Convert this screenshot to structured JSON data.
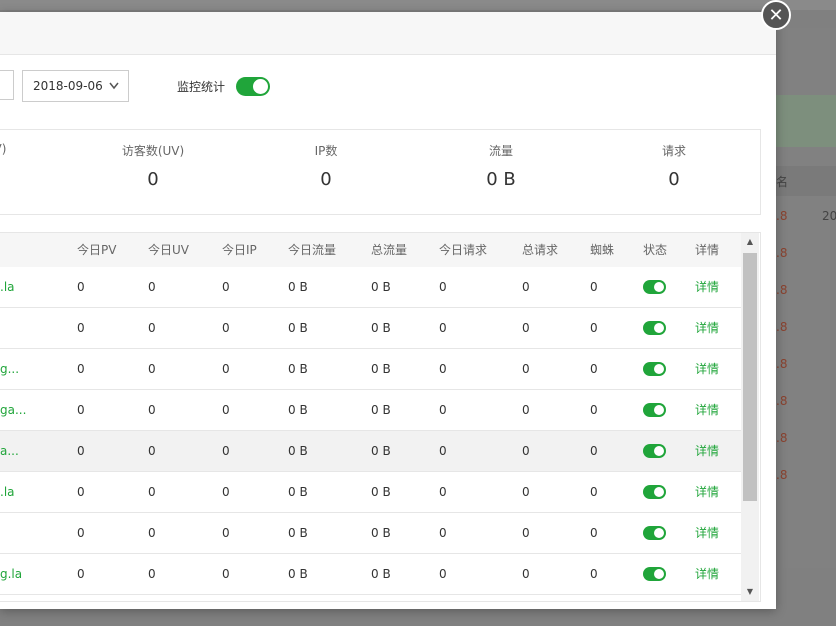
{
  "background": {
    "header_partial": "名",
    "rows": [
      ".8",
      ".8",
      ".8",
      ".8",
      ".8",
      ".8",
      ".8",
      ".8"
    ],
    "header_extra": "20"
  },
  "toolbar": {
    "date_value": "2018-09-06",
    "monitor_label": "监控统计",
    "monitor_enabled": true
  },
  "stats": [
    {
      "label": "V)",
      "value": ""
    },
    {
      "label": "访客数(UV)",
      "value": "0"
    },
    {
      "label": "IP数",
      "value": "0"
    },
    {
      "label": "流量",
      "value": "0 B"
    },
    {
      "label": "请求",
      "value": "0"
    }
  ],
  "table": {
    "headers": [
      "今日PV",
      "今日UV",
      "今日IP",
      "今日流量",
      "总流量",
      "今日请求",
      "总请求",
      "蜘蛛",
      "状态",
      "详情"
    ],
    "rows": [
      {
        "site": ".la",
        "pv": "0",
        "uv": "0",
        "ip": "0",
        "today_flow": "0 B",
        "total_flow": "0 B",
        "today_req": "0",
        "total_req": "0",
        "spider": "0",
        "status_on": true,
        "detail": "详情"
      },
      {
        "site": "",
        "pv": "0",
        "uv": "0",
        "ip": "0",
        "today_flow": "0 B",
        "total_flow": "0 B",
        "today_req": "0",
        "total_req": "0",
        "spider": "0",
        "status_on": true,
        "detail": "详情"
      },
      {
        "site": "g...",
        "pv": "0",
        "uv": "0",
        "ip": "0",
        "today_flow": "0 B",
        "total_flow": "0 B",
        "today_req": "0",
        "total_req": "0",
        "spider": "0",
        "status_on": true,
        "detail": "详情"
      },
      {
        "site": "ga...",
        "pv": "0",
        "uv": "0",
        "ip": "0",
        "today_flow": "0 B",
        "total_flow": "0 B",
        "today_req": "0",
        "total_req": "0",
        "spider": "0",
        "status_on": true,
        "detail": "详情"
      },
      {
        "site": "a...",
        "pv": "0",
        "uv": "0",
        "ip": "0",
        "today_flow": "0 B",
        "total_flow": "0 B",
        "today_req": "0",
        "total_req": "0",
        "spider": "0",
        "status_on": true,
        "detail": "详情"
      },
      {
        "site": ".la",
        "pv": "0",
        "uv": "0",
        "ip": "0",
        "today_flow": "0 B",
        "total_flow": "0 B",
        "today_req": "0",
        "total_req": "0",
        "spider": "0",
        "status_on": true,
        "detail": "详情"
      },
      {
        "site": "",
        "pv": "0",
        "uv": "0",
        "ip": "0",
        "today_flow": "0 B",
        "total_flow": "0 B",
        "today_req": "0",
        "total_req": "0",
        "spider": "0",
        "status_on": true,
        "detail": "详情"
      },
      {
        "site": "g.la",
        "pv": "0",
        "uv": "0",
        "ip": "0",
        "today_flow": "0 B",
        "total_flow": "0 B",
        "today_req": "0",
        "total_req": "0",
        "spider": "0",
        "status_on": true,
        "detail": "详情"
      }
    ]
  },
  "icons": {
    "close": "close-icon",
    "dropdown": "chevron-down-icon",
    "scroll_up": "arrow-up-icon",
    "scroll_down": "arrow-down-icon"
  },
  "colors": {
    "accent": "#20a53a",
    "overlay": "#808080"
  }
}
